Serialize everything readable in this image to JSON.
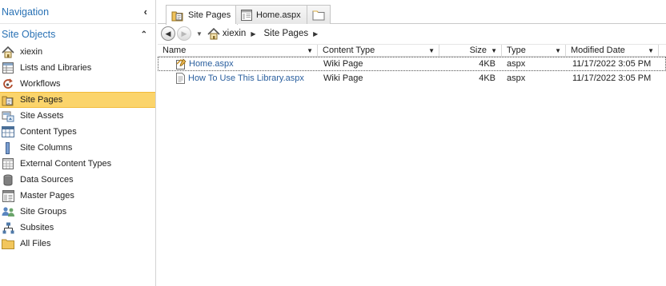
{
  "navigation": {
    "title": "Navigation",
    "site_objects_title": "Site Objects",
    "items": [
      {
        "label": "xiexin",
        "icon": "home-icon"
      },
      {
        "label": "Lists and Libraries",
        "icon": "list-icon"
      },
      {
        "label": "Workflows",
        "icon": "workflow-icon"
      },
      {
        "label": "Site Pages",
        "icon": "site-pages-icon",
        "selected": true
      },
      {
        "label": "Site Assets",
        "icon": "site-assets-icon"
      },
      {
        "label": "Content Types",
        "icon": "content-types-icon"
      },
      {
        "label": "Site Columns",
        "icon": "site-columns-icon"
      },
      {
        "label": "External Content Types",
        "icon": "external-content-icon"
      },
      {
        "label": "Data Sources",
        "icon": "database-icon"
      },
      {
        "label": "Master Pages",
        "icon": "master-pages-icon"
      },
      {
        "label": "Site Groups",
        "icon": "groups-icon"
      },
      {
        "label": "Subsites",
        "icon": "subsites-icon"
      },
      {
        "label": "All Files",
        "icon": "folder-icon"
      }
    ]
  },
  "tabs": [
    {
      "label": "Site Pages",
      "active": true
    },
    {
      "label": "Home.aspx",
      "active": false
    },
    {
      "label": "",
      "active": false
    }
  ],
  "breadcrumb": {
    "items": [
      "xiexin",
      "Site Pages"
    ]
  },
  "grid": {
    "columns": [
      "Name",
      "Content Type",
      "Size",
      "Type",
      "Modified Date"
    ],
    "rows": [
      {
        "name": "Home.aspx",
        "content_type": "Wiki Page",
        "size": "4KB",
        "type": "aspx",
        "modified": "11/17/2022 3:05 PM"
      },
      {
        "name": "How To Use This Library.aspx",
        "content_type": "Wiki Page",
        "size": "4KB",
        "type": "aspx",
        "modified": "11/17/2022 3:05 PM"
      }
    ]
  },
  "colors": {
    "accent": "#2a72b5",
    "selected_bg": "#fbd46b",
    "link": "#2a5f9e"
  }
}
